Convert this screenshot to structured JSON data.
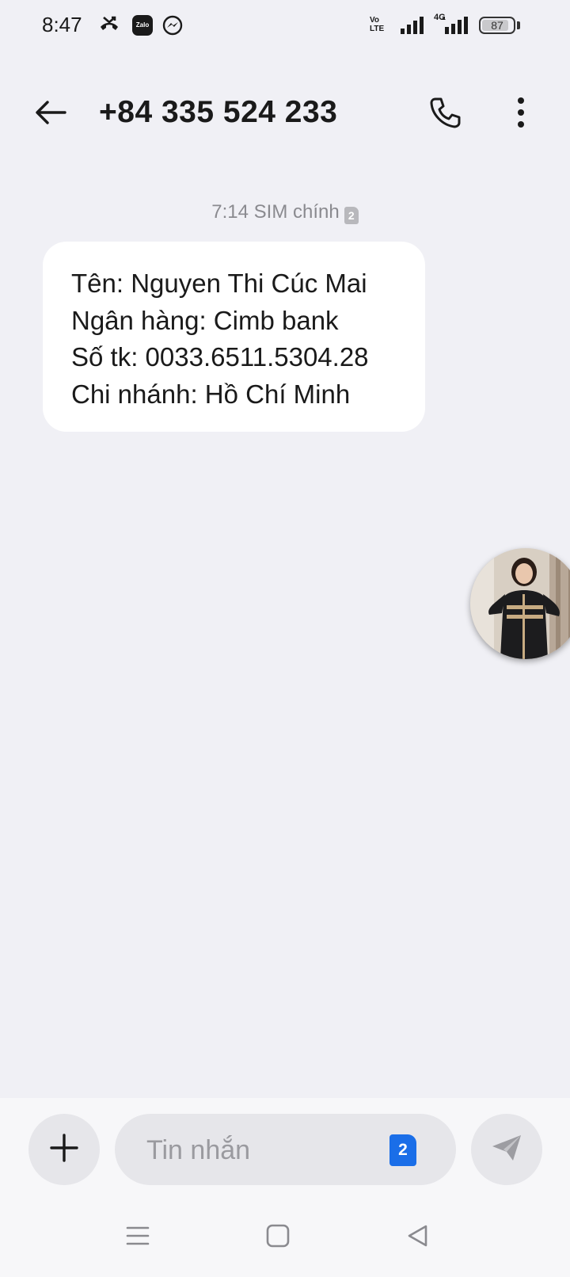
{
  "status_bar": {
    "time": "8:47",
    "notification_icons": [
      "missed-call-icon",
      "zalo-icon",
      "messenger-icon"
    ],
    "zalo_label": "Zalo",
    "volte_label": "Vo LTE",
    "network_label": "4G",
    "battery_percent": "87"
  },
  "header": {
    "title": "+84 335 524 233",
    "icons": [
      "back-arrow-icon",
      "phone-icon",
      "more-vertical-icon"
    ]
  },
  "conversation": {
    "messages": [
      {
        "meta": "7:14 SIM chính",
        "sim_badge": "2",
        "lines": [
          "Tên: Nguyen Thi Cúc Mai",
          "Ngân hàng: Cimb bank",
          "Số tk: 0033.6511.5304.28",
          "Chi nhánh: Hồ Chí Minh"
        ]
      }
    ]
  },
  "composer": {
    "placeholder": "Tin nhắn",
    "sim_number": "2",
    "icons": [
      "plus-icon",
      "send-icon"
    ]
  },
  "nav_bar": {
    "icons": [
      "menu-icon",
      "home-icon",
      "back-triangle-icon"
    ]
  },
  "colors": {
    "background": "#f0f0f5",
    "bubble": "#ffffff",
    "accent": "#1a6ee8",
    "meta_text": "#8a8a8f"
  }
}
